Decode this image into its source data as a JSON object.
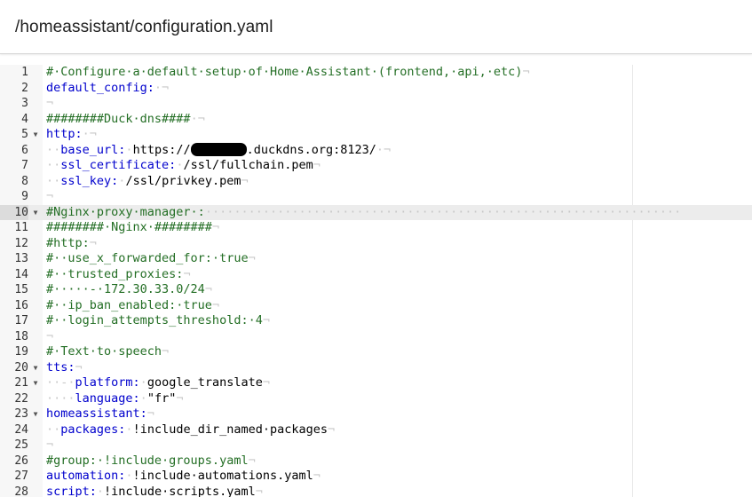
{
  "header": {
    "title": "/homeassistant/configuration.yaml"
  },
  "editor": {
    "active_line": 10,
    "lines": [
      {
        "n": "1",
        "fold": false,
        "tokens": [
          {
            "t": "c",
            "v": "#·Configure·a·default·setup·of·Home·Assistant·(frontend,·api,·etc)"
          },
          {
            "t": "ws",
            "v": "¬"
          }
        ]
      },
      {
        "n": "2",
        "fold": false,
        "tokens": [
          {
            "t": "k",
            "v": "default_config:"
          },
          {
            "t": "ws",
            "v": "·¬"
          }
        ]
      },
      {
        "n": "3",
        "fold": false,
        "tokens": [
          {
            "t": "ws",
            "v": "¬"
          }
        ]
      },
      {
        "n": "4",
        "fold": false,
        "tokens": [
          {
            "t": "c",
            "v": "########Duck·dns####"
          },
          {
            "t": "ws",
            "v": "·¬"
          }
        ]
      },
      {
        "n": "5",
        "fold": true,
        "tokens": [
          {
            "t": "k",
            "v": "http:"
          },
          {
            "t": "ws",
            "v": "·¬"
          }
        ]
      },
      {
        "n": "6",
        "fold": false,
        "tokens": [
          {
            "t": "ws",
            "v": "··"
          },
          {
            "t": "k",
            "v": "base_url:"
          },
          {
            "t": "ws",
            "v": "·"
          },
          {
            "t": "v",
            "v": "https://"
          },
          {
            "t": "redact",
            "v": ""
          },
          {
            "t": "v",
            "v": ".duckdns.org:8123/"
          },
          {
            "t": "ws",
            "v": "·¬"
          }
        ]
      },
      {
        "n": "7",
        "fold": false,
        "tokens": [
          {
            "t": "ws",
            "v": "··"
          },
          {
            "t": "k",
            "v": "ssl_certificate:"
          },
          {
            "t": "ws",
            "v": "·"
          },
          {
            "t": "v",
            "v": "/ssl/fullchain.pem"
          },
          {
            "t": "ws",
            "v": "¬"
          }
        ]
      },
      {
        "n": "8",
        "fold": false,
        "tokens": [
          {
            "t": "ws",
            "v": "··"
          },
          {
            "t": "k",
            "v": "ssl_key:"
          },
          {
            "t": "ws",
            "v": "·"
          },
          {
            "t": "v",
            "v": "/ssl/privkey.pem"
          },
          {
            "t": "ws",
            "v": "¬"
          }
        ]
      },
      {
        "n": "9",
        "fold": false,
        "tokens": [
          {
            "t": "ws",
            "v": "¬"
          }
        ]
      },
      {
        "n": "10",
        "fold": true,
        "tokens": [
          {
            "t": "c",
            "v": "#Nginx·proxy·manager·:"
          },
          {
            "t": "ws",
            "v": "··································································"
          }
        ]
      },
      {
        "n": "11",
        "fold": false,
        "tokens": [
          {
            "t": "c",
            "v": "########·Nginx·########"
          },
          {
            "t": "ws",
            "v": "¬"
          }
        ]
      },
      {
        "n": "12",
        "fold": false,
        "tokens": [
          {
            "t": "c",
            "v": "#http:"
          },
          {
            "t": "ws",
            "v": "¬"
          }
        ]
      },
      {
        "n": "13",
        "fold": false,
        "tokens": [
          {
            "t": "c",
            "v": "#··use_x_forwarded_for:·true"
          },
          {
            "t": "ws",
            "v": "¬"
          }
        ]
      },
      {
        "n": "14",
        "fold": false,
        "tokens": [
          {
            "t": "c",
            "v": "#··trusted_proxies:"
          },
          {
            "t": "ws",
            "v": "¬"
          }
        ]
      },
      {
        "n": "15",
        "fold": false,
        "tokens": [
          {
            "t": "c",
            "v": "#·····-·172.30.33.0/24"
          },
          {
            "t": "ws",
            "v": "¬"
          }
        ]
      },
      {
        "n": "16",
        "fold": false,
        "tokens": [
          {
            "t": "c",
            "v": "#··ip_ban_enabled:·true"
          },
          {
            "t": "ws",
            "v": "¬"
          }
        ]
      },
      {
        "n": "17",
        "fold": false,
        "tokens": [
          {
            "t": "c",
            "v": "#··login_attempts_threshold:·4"
          },
          {
            "t": "ws",
            "v": "¬"
          }
        ]
      },
      {
        "n": "18",
        "fold": false,
        "tokens": [
          {
            "t": "ws",
            "v": "¬"
          }
        ]
      },
      {
        "n": "19",
        "fold": false,
        "tokens": [
          {
            "t": "c",
            "v": "#·Text·to·speech"
          },
          {
            "t": "ws",
            "v": "¬"
          }
        ]
      },
      {
        "n": "20",
        "fold": true,
        "tokens": [
          {
            "t": "k",
            "v": "tts:"
          },
          {
            "t": "ws",
            "v": "¬"
          }
        ]
      },
      {
        "n": "21",
        "fold": true,
        "tokens": [
          {
            "t": "ws",
            "v": "··-·"
          },
          {
            "t": "k",
            "v": "platform:"
          },
          {
            "t": "ws",
            "v": "·"
          },
          {
            "t": "v",
            "v": "google_translate"
          },
          {
            "t": "ws",
            "v": "¬"
          }
        ]
      },
      {
        "n": "22",
        "fold": false,
        "tokens": [
          {
            "t": "ws",
            "v": "····"
          },
          {
            "t": "k",
            "v": "language:"
          },
          {
            "t": "ws",
            "v": "·"
          },
          {
            "t": "v",
            "v": "\"fr\""
          },
          {
            "t": "ws",
            "v": "¬"
          }
        ]
      },
      {
        "n": "23",
        "fold": true,
        "tokens": [
          {
            "t": "k",
            "v": "homeassistant:"
          },
          {
            "t": "ws",
            "v": "¬"
          }
        ]
      },
      {
        "n": "24",
        "fold": false,
        "tokens": [
          {
            "t": "ws",
            "v": "··"
          },
          {
            "t": "k",
            "v": "packages:"
          },
          {
            "t": "ws",
            "v": "·"
          },
          {
            "t": "v",
            "v": "!include_dir_named·packages"
          },
          {
            "t": "ws",
            "v": "¬"
          }
        ]
      },
      {
        "n": "25",
        "fold": false,
        "tokens": [
          {
            "t": "ws",
            "v": "¬"
          }
        ]
      },
      {
        "n": "26",
        "fold": false,
        "tokens": [
          {
            "t": "c",
            "v": "#group:·!include·groups.yaml"
          },
          {
            "t": "ws",
            "v": "¬"
          }
        ]
      },
      {
        "n": "27",
        "fold": false,
        "tokens": [
          {
            "t": "k",
            "v": "automation:"
          },
          {
            "t": "ws",
            "v": "·"
          },
          {
            "t": "v",
            "v": "!include·automations.yaml"
          },
          {
            "t": "ws",
            "v": "¬"
          }
        ]
      },
      {
        "n": "28",
        "fold": false,
        "tokens": [
          {
            "t": "k",
            "v": "script:"
          },
          {
            "t": "ws",
            "v": "·"
          },
          {
            "t": "v",
            "v": "!include·scripts.yaml"
          },
          {
            "t": "ws",
            "v": "¬"
          }
        ]
      }
    ]
  },
  "colors": {
    "comment": "#236e24",
    "key": "#0000cd",
    "value": "#000000",
    "whitespace": "#c8c8c8",
    "active_line_bg": "#ececec"
  },
  "icons": {
    "fold": "fold-triangle-icon"
  }
}
